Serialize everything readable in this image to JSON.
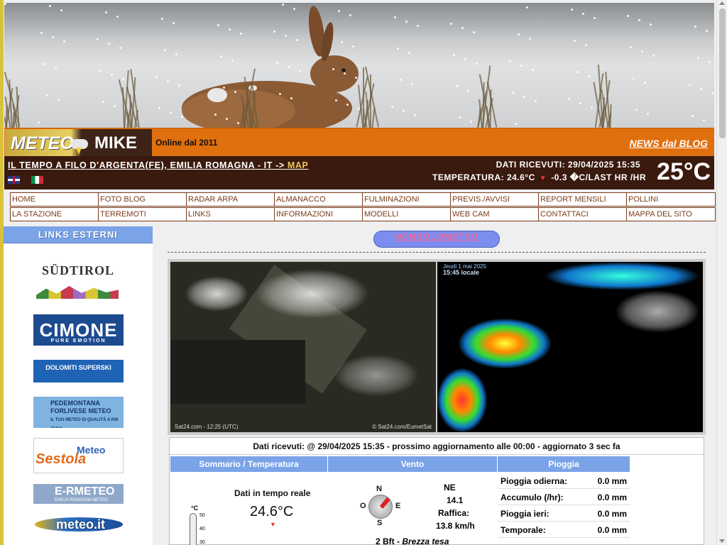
{
  "header": {
    "logo_left": "METEO",
    "logo_right": "MIKE",
    "online_since": "Online dal 2011",
    "news_link": "NEWS dal BLOG",
    "tagline": "IL TEMPO A FILO D'ARGENTA(FE), EMILIA ROMAGNA - IT ->",
    "map_link": "MAP",
    "dati_ricevuti": "DATI RICEVUTI:  29/04/2025 15:35",
    "temperatura": "TEMPERATURA: 24.6°C",
    "trend": "-0.3 �C/LAST HR /HR",
    "big_temp": "25°C"
  },
  "nav": [
    [
      "HOME",
      "FOTO BLOG",
      "RADAR ARPA",
      "ALMANACCO",
      "FULMINAZIONI",
      "PREVIS./AVVISI",
      "REPORT MENSILI",
      "POLLINI"
    ],
    [
      "LA STAZIONE",
      "TERREMOTI",
      "LINKS",
      "INFORMAZIONI",
      "MODELLI",
      "WEB CAM",
      "CONTATTACI",
      "MAPPA DEL SITO"
    ]
  ],
  "sidebar": {
    "title": "LINKS ESTERNI",
    "sponsors": [
      {
        "name": "SÜDTIROL"
      },
      {
        "name": "CIMONE",
        "tagline": "PURE EMOTION"
      },
      {
        "name": "DOLOMITI SUPERSKI"
      },
      {
        "name": "PEDEMONTANA FORLIVESE METEO",
        "tagline": "IL TUO METEO DI QUALITÀ A KM ZERO"
      },
      {
        "name": "Sestola",
        "tagline": "Meteo"
      },
      {
        "name": "E-RMETEO",
        "tagline": "EMILIA ROMAGNA METEO"
      },
      {
        "name": "meteo.it"
      }
    ]
  },
  "main": {
    "pill_link": "NONSOLOMETEO",
    "sat_left_caption": "Sat24.com - 12:25 (UTC)",
    "sat_left_credit": "© Sat24.com/EumetSat",
    "sat_right_title": "Jeudi 1 mai 2025",
    "sat_right_time": "15:45 locale",
    "status_line": "Dati ricevuti: @ 29/04/2025 15:35 - prossimo aggiornamento alle 00:00   - aggiornato 3 sec fa",
    "columns": [
      "Sommario / Temperatura",
      "Vento",
      "Pioggia"
    ],
    "realtime_label": "Dati in tempo reale",
    "realtime_temp": "24.6°C",
    "thermo_unit": "°C",
    "thermo_ticks": [
      "50",
      "40",
      "30"
    ],
    "compass": {
      "n": "N",
      "e": "E",
      "s": "S",
      "o": "O"
    },
    "wind_dir": "NE",
    "wind_speed": "14.1",
    "gust_label": "Raffica:",
    "gust_value": "13.8 km/h",
    "beaufort": "2 Bft -",
    "beaufort_desc": "Brezza tesa",
    "rain": [
      {
        "label": "Pioggia odierna:",
        "value": "0.0 mm"
      },
      {
        "label": "Accumulo (/hr):",
        "value": "0.0 mm"
      },
      {
        "label": "Pioggia ieri:",
        "value": "0.0 mm"
      },
      {
        "label": "Temporale:",
        "value": "0.0 mm"
      }
    ]
  },
  "colors": {
    "orange": "#e0700d",
    "dark_brown": "#3a1a0e",
    "nav_border": "#7a3b1a",
    "accent_blue": "#7aa3e8",
    "pill": "#7b8ef0"
  }
}
